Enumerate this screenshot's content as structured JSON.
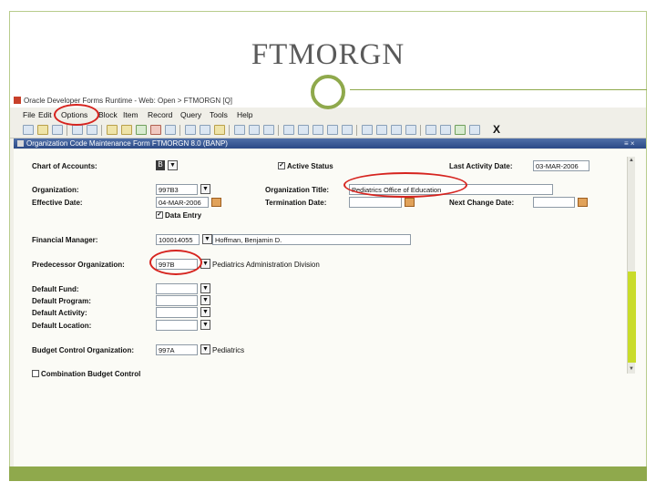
{
  "slide": {
    "title": "FTMORGN"
  },
  "window": {
    "title": "Oracle Developer Forms Runtime - Web: Open > FTMORGN [Q]"
  },
  "menu": [
    "File",
    "Edit",
    "Options",
    "Block",
    "Item",
    "Record",
    "Query",
    "Tools",
    "Help"
  ],
  "toolbar": {
    "close_label": "X"
  },
  "form": {
    "title": "Organization Code Maintenance Form  FTMORGN  8.0  (BANP)",
    "controls": "≡  ×"
  },
  "fields": {
    "chart_label": "Chart of Accounts:",
    "chart_value": "B",
    "active_status_label": "Active Status",
    "active_status_checked": true,
    "last_activity_label": "Last Activity Date:",
    "last_activity_value": "03-MAR-2006",
    "organization_label": "Organization:",
    "organization_value": "997B3",
    "org_title_label": "Organization Title:",
    "org_title_value": "Pediatrics Office of Education",
    "effective_date_label": "Effective Date:",
    "effective_date_value": "04-MAR-2006",
    "termination_date_label": "Termination Date:",
    "termination_date_value": "",
    "next_change_label": "Next Change Date:",
    "next_change_value": "",
    "data_entry_label": "Data Entry",
    "data_entry_checked": true,
    "financial_manager_label": "Financial Manager:",
    "financial_manager_id": "100014055",
    "financial_manager_name": "Hoffman, Benjamin D.",
    "predecessor_label": "Predecessor Organization:",
    "predecessor_value": "997B",
    "predecessor_desc": "Pediatrics Administration Division",
    "default_fund_label": "Default Fund:",
    "default_program_label": "Default Program:",
    "default_activity_label": "Default Activity:",
    "default_location_label": "Default Location:",
    "budget_control_label": "Budget Control Organization:",
    "budget_control_value": "997A",
    "budget_control_desc": "Pediatrics",
    "combination_budget_label": "Combination Budget Control",
    "combination_budget_checked": false
  },
  "colors": {
    "highlight": "#d6241f",
    "accent": "#8fa94c",
    "form_bar": "#2b4a86",
    "scroll_thumb": "#c9dc2a"
  }
}
